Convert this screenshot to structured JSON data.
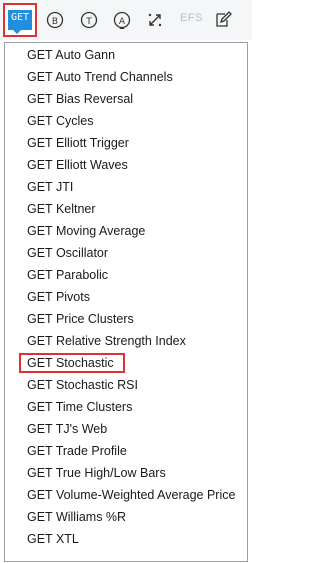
{
  "toolbar": {
    "get_label": "GET",
    "efs_label": "EFS",
    "icons": [
      "b-circle-icon",
      "t-circle-icon",
      "a-circle-icon",
      "arrows-icon",
      "edit-icon"
    ]
  },
  "menu": {
    "items": [
      "GET Auto Gann",
      "GET Auto Trend Channels",
      "GET Bias Reversal",
      "GET Cycles",
      "GET Elliott Trigger",
      "GET Elliott Waves",
      "GET JTI",
      "GET Keltner",
      "GET Moving Average",
      "GET Oscillator",
      "GET Parabolic",
      "GET Pivots",
      "GET Price Clusters",
      "GET Relative Strength Index",
      "GET Stochastic",
      "GET Stochastic RSI",
      "GET Time Clusters",
      "GET TJ's Web",
      "GET Trade Profile",
      "GET True High/Low Bars",
      "GET Volume-Weighted Average Price",
      "GET Williams %R",
      "GET XTL"
    ],
    "highlighted": "GET Stochastic"
  },
  "colors": {
    "accent": "#1f8fe0",
    "highlight_border": "#e0302f"
  }
}
